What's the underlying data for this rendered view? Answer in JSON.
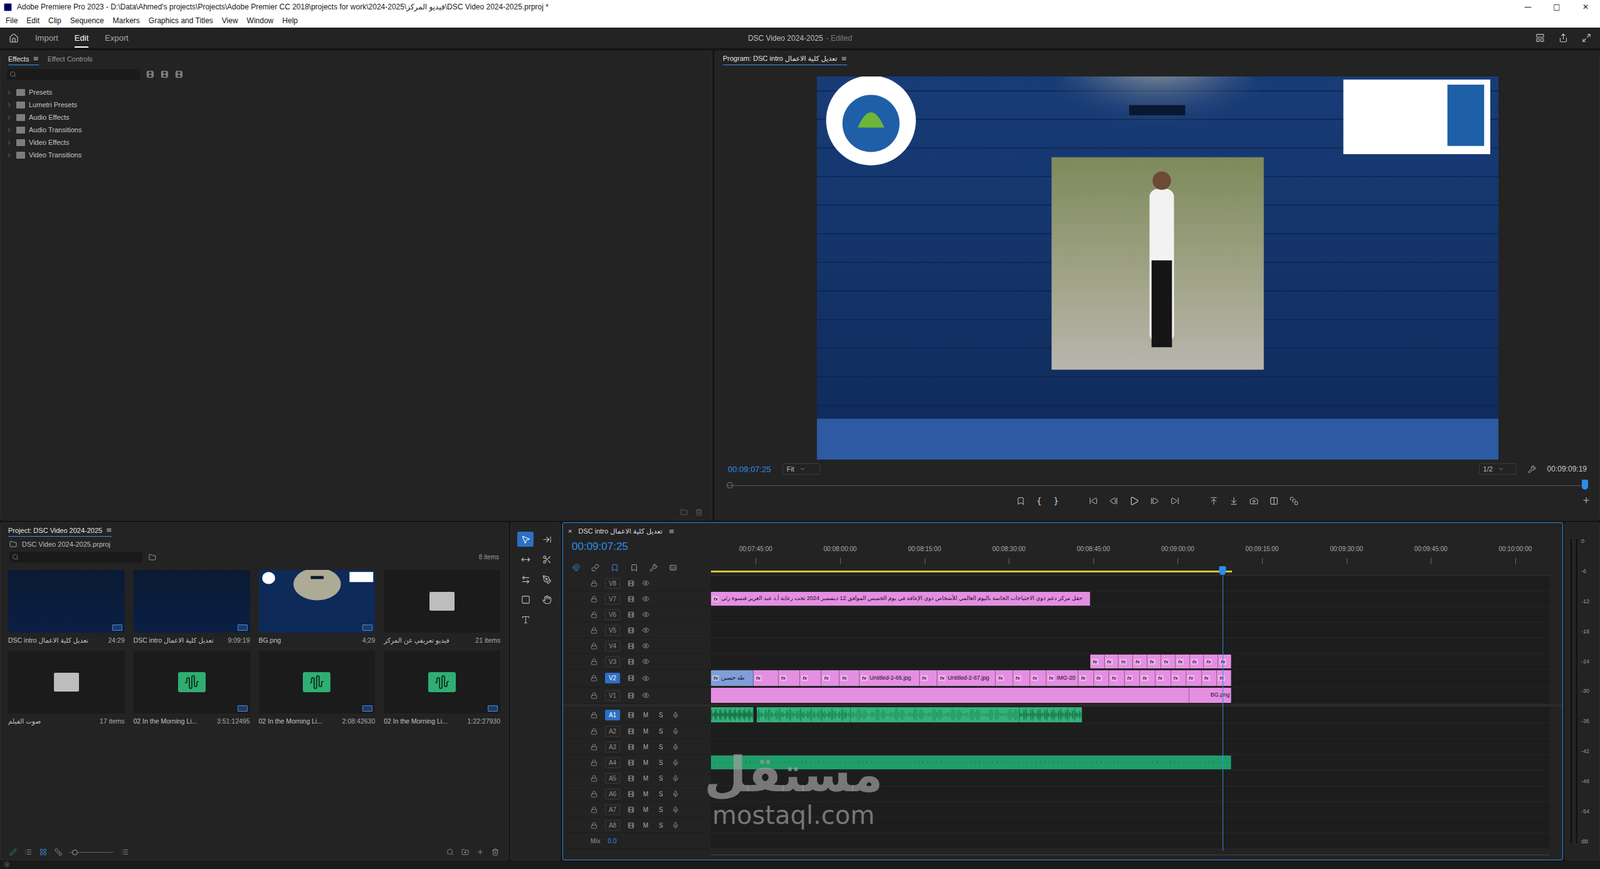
{
  "window": {
    "title": "Adobe Premiere Pro 2023 - D:\\Data\\Ahmed's projects\\Projects\\Adobe Premier CC 2018\\projects for work\\2024-2025\\فيديو المركز\\DSC Video 2024-2025.prproj *",
    "controls": [
      "—",
      "□",
      "✕"
    ]
  },
  "menu": [
    "File",
    "Edit",
    "Clip",
    "Sequence",
    "Markers",
    "Graphics and Titles",
    "View",
    "Window",
    "Help"
  ],
  "workspaces": [
    {
      "label": "Import",
      "selected": false
    },
    {
      "label": "Edit",
      "selected": true
    },
    {
      "label": "Export",
      "selected": false
    }
  ],
  "project_title": {
    "name": "DSC Video 2024-2025",
    "status": "- Edited"
  },
  "effects_panel": {
    "tabs": [
      {
        "label": "Effects",
        "selected": true
      },
      {
        "label": "Effect Controls",
        "selected": false
      }
    ],
    "menu": "≡",
    "tree": [
      {
        "label": "Presets",
        "expanded": false
      },
      {
        "label": "Lumetri Presets",
        "expanded": false
      },
      {
        "label": "Audio Effects",
        "expanded": false
      },
      {
        "label": "Audio Transitions",
        "expanded": false
      },
      {
        "label": "Video Effects",
        "expanded": false
      },
      {
        "label": "Video Transitions",
        "expanded": false
      }
    ]
  },
  "program": {
    "title": "Program: DSC intro تعديل كلية الاعمال",
    "menu": "≡",
    "timecode": "00:09:07:25",
    "zoom": "Fit",
    "resolution": "1/2",
    "duration": "00:09:09:19",
    "scrub": {
      "level": 0.996
    },
    "in_mark": "{",
    "out_mark": "}"
  },
  "project": {
    "title": "Project: DSC Video 2024-2025",
    "menu": "≡",
    "file": "DSC Video 2024-2025.prproj",
    "count": "8 items",
    "zoom": {
      "level": 0.05
    },
    "items": [
      {
        "name": "DSC intro تعديل كلية الاعمال",
        "info": "24:29",
        "kind": "sequence"
      },
      {
        "name": "DSC intro تعديل كلية الاعمال",
        "info": "9:09:19",
        "kind": "sequence"
      },
      {
        "name": "BG.png",
        "info": "4;29",
        "kind": "image"
      },
      {
        "name": "فيديو تعريفي عن المركز",
        "info": "21 items",
        "kind": "bin"
      },
      {
        "name": "صوت الفيلم",
        "info": "17 items",
        "kind": "bin"
      },
      {
        "name": "02 In the Morning Li...",
        "info": "3:51:12495",
        "kind": "audio"
      },
      {
        "name": "02 In the Morning Li...",
        "info": "2:08:42630",
        "kind": "audio"
      },
      {
        "name": "02 In the Morning Li...",
        "info": "1:22:27930",
        "kind": "audio"
      }
    ]
  },
  "tools": [
    {
      "selected": true
    },
    {
      "selected": false
    },
    {
      "selected": false
    },
    {
      "selected": false
    },
    {
      "selected": false
    },
    {
      "selected": false
    },
    {
      "selected": false
    },
    {
      "selected": false
    },
    {
      "selected": false
    }
  ],
  "timeline": {
    "title": "DSC intro تعديل كلية الاعمال",
    "close": "×",
    "menu": "≡",
    "timecode": "00:09:07:25",
    "tools": [
      {
        "selected": true
      },
      {
        "selected": false
      },
      {
        "selected": true
      },
      {
        "selected": false
      },
      {
        "selected": false
      },
      {
        "selected": false
      }
    ],
    "ruler": [
      "00:07:45:00",
      "00:08:00:00",
      "00:08:15:00",
      "00:08:30:00",
      "00:08:45:00",
      "00:09:00:00",
      "00:09:15:00",
      "00:09:30:00",
      "00:09:45:00",
      "00:10:00:00"
    ],
    "playhead": {
      "level": 0.61
    },
    "work_area": {
      "level": 0.621
    },
    "video_tracks": [
      {
        "label": "V8",
        "targeted": false,
        "clips": []
      },
      {
        "label": "V7",
        "targeted": false,
        "clips": [
          {
            "segments": [
              {
                "label": "حفل مركز دعم ذوي الاحتياجات الخاصة باليوم العالمي للأشخاص ذوي الإعاقة في يوم الخميس الموافق 12 ديسمبر 2024 تحت رعاية أ.د عبد العزيز قنصوة رئي",
                "badge": "fx",
                "color": "#e48fe2"
              }
            ]
          }
        ]
      },
      {
        "label": "V6",
        "targeted": false,
        "clips": []
      },
      {
        "label": "V5",
        "targeted": false,
        "clips": []
      },
      {
        "label": "V4",
        "targeted": false,
        "clips": []
      },
      {
        "label": "V3",
        "targeted": false,
        "clips": [
          {
            "segments": [
              {
                "badge": "fx",
                "color": "#e48fe2"
              },
              {
                "badge": "fx",
                "color": "#e48fe2"
              },
              {
                "badge": "fx",
                "color": "#e48fe2"
              },
              {
                "badge": "fx",
                "color": "#e48fe2"
              },
              {
                "badge": "fx",
                "color": "#e48fe2"
              },
              {
                "badge": "fx",
                "color": "#e48fe2"
              },
              {
                "badge": "fx",
                "color": "#e48fe2"
              },
              {
                "badge": "fx",
                "color": "#e48fe2"
              },
              {
                "badge": "fx",
                "color": "#e48fe2"
              },
              {
                "badge": "fx",
                "color": "#e48fe2"
              }
            ]
          }
        ]
      },
      {
        "label": "V2",
        "targeted": true,
        "clips": [
          {
            "segments": [
              {
                "label": "طه حسين",
                "badge": "fx",
                "color": "#7f9ed8"
              },
              {
                "badge": "fx",
                "color": "#e48fe2"
              },
              {
                "badge": "fx",
                "color": "#e48fe2"
              },
              {
                "badge": "fx",
                "color": "#e48fe2"
              },
              {
                "badge": "fx",
                "color": "#e48fe2"
              },
              {
                "badge": "fx",
                "color": "#e48fe2"
              },
              {
                "label": "Untitled-2-66.jpg",
                "badge": "fx",
                "color": "#e48fe2"
              },
              {
                "badge": "fx",
                "color": "#e48fe2"
              },
              {
                "label": "Untitled-2-67.jpg",
                "badge": "fx",
                "color": "#e48fe2"
              },
              {
                "badge": "fx",
                "color": "#e48fe2"
              },
              {
                "badge": "fx",
                "color": "#e48fe2"
              },
              {
                "badge": "fx",
                "color": "#e48fe2"
              },
              {
                "label": "IMG-20",
                "badge": "fx",
                "color": "#e48fe2"
              },
              {
                "badge": "fx",
                "color": "#e48fe2"
              },
              {
                "badge": "fx",
                "color": "#e48fe2"
              },
              {
                "badge": "fx",
                "color": "#e48fe2"
              },
              {
                "badge": "fx",
                "color": "#e48fe2"
              },
              {
                "badge": "fx",
                "color": "#e48fe2"
              },
              {
                "badge": "fx",
                "color": "#e48fe2"
              },
              {
                "badge": "fx",
                "color": "#e48fe2"
              },
              {
                "badge": "fx",
                "color": "#e48fe2"
              },
              {
                "badge": "fx",
                "color": "#e48fe2"
              },
              {
                "badge": "fx",
                "color": "#e48fe2"
              }
            ]
          }
        ]
      },
      {
        "label": "V1",
        "targeted": false,
        "clips": [
          {
            "segments": [
              {
                "color": "#e48fe2"
              },
              {
                "label": "BG.png",
                "color": "#e48fe2"
              }
            ]
          }
        ]
      }
    ],
    "audio_tracks": [
      {
        "label": "A1",
        "targeted": true,
        "mute": "M",
        "solo": "S",
        "clips": [
          {
            "color": "#34b27b",
            "segments": [
              {
                "waveform": true
              }
            ]
          },
          {
            "color": "#34b27b",
            "segments": [
              {
                "waveform": true
              },
              {
                "waveform": true
              },
              {
                "waveform": true
              }
            ]
          }
        ]
      },
      {
        "label": "A2",
        "targeted": false,
        "mute": "M",
        "solo": "S",
        "clips": []
      },
      {
        "label": "A3",
        "targeted": false,
        "mute": "M",
        "solo": "S",
        "clips": []
      },
      {
        "label": "A4",
        "targeted": false,
        "mute": "M",
        "solo": "S",
        "clips": [
          {
            "color": "#1f9e6a",
            "segments": [
              {
                "waveform": false
              }
            ]
          }
        ]
      },
      {
        "label": "A5",
        "targeted": false,
        "mute": "M",
        "solo": "S",
        "clips": []
      },
      {
        "label": "A6",
        "targeted": false,
        "mute": "M",
        "solo": "S",
        "clips": []
      },
      {
        "label": "A7",
        "targeted": false,
        "mute": "M",
        "solo": "S",
        "clips": []
      },
      {
        "label": "A8",
        "targeted": false,
        "mute": "M",
        "solo": "S",
        "clips": []
      }
    ],
    "mix": {
      "label": "Mix",
      "value": "0.0"
    }
  },
  "meter": {
    "ticks": [
      "0",
      "-6",
      "-12",
      "-18",
      "-24",
      "-30",
      "-36",
      "-42",
      "-48",
      "-54",
      "dB"
    ]
  },
  "watermark": {
    "arabic": "مستقل",
    "latin": "mostaql.com"
  }
}
